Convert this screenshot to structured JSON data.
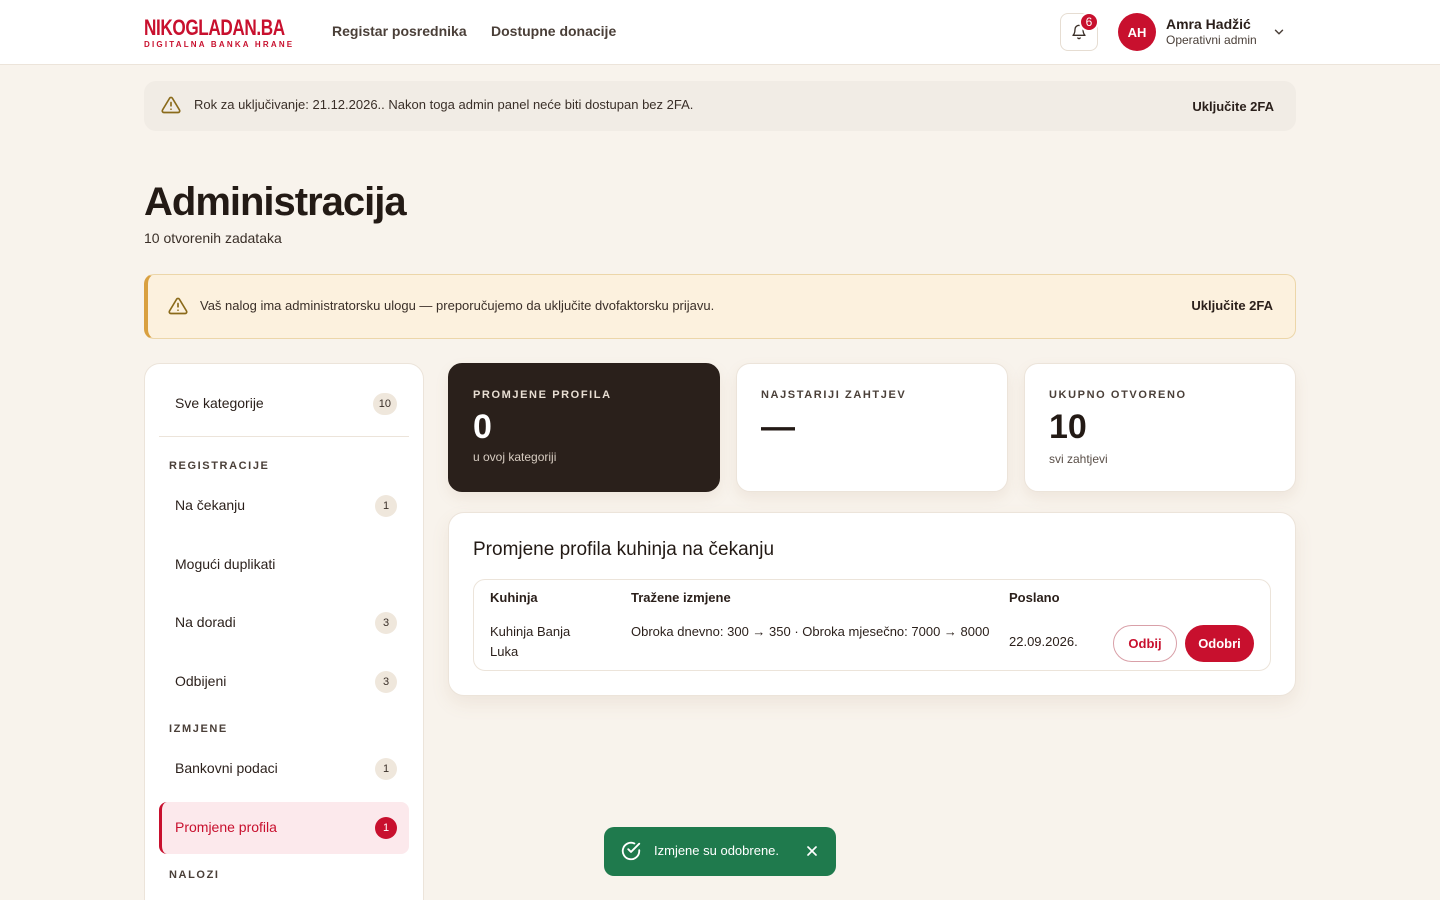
{
  "header": {
    "logo_main": "NIKOGLADAN.BA",
    "logo_sub": "DIGITALNA BANKA HRANE",
    "nav": [
      "Registar posrednika",
      "Dostupne donacije"
    ],
    "notifications_count": "6",
    "user": {
      "initials": "AH",
      "name": "Amra Hadžić",
      "role": "Operativni admin"
    }
  },
  "notice_top": {
    "text": "Rok za uključivanje: 21.12.2026.. Nakon toga admin panel neće biti dostupan bez 2FA.",
    "action": "Uključite 2FA"
  },
  "page": {
    "title": "Administracija",
    "subtitle": "10 otvorenih zadataka"
  },
  "notice_2fa": {
    "text": "Vaš nalog ima administratorsku ulogu — preporučujemo da uključite dvofaktorsku prijavu.",
    "action": "Uključite 2FA"
  },
  "sidebar": {
    "all": {
      "label": "Sve kategorije",
      "count": "10"
    },
    "sections": [
      "REGISTRACIJE",
      "IZMJENE",
      "NALOZI"
    ],
    "items": [
      {
        "label": "Na čekanju",
        "count": "1"
      },
      {
        "label": "Mogući duplikati",
        "count": ""
      },
      {
        "label": "Na doradi",
        "count": "3"
      },
      {
        "label": "Odbijeni",
        "count": "3"
      },
      {
        "label": "Bankovni podaci",
        "count": "1"
      },
      {
        "label": "Promjene profila",
        "count": "1"
      }
    ]
  },
  "stats": [
    {
      "caption": "PROMJENE PROFILA",
      "value": "0",
      "note": "u ovoj kategoriji"
    },
    {
      "caption": "NAJSTARIJI ZAHTJEV",
      "value": "—",
      "note": ""
    },
    {
      "caption": "UKUPNO OTVORENO",
      "value": "10",
      "note": "svi zahtjevi"
    }
  ],
  "pending": {
    "title": "Promjene profila kuhinja na čekanju",
    "columns": [
      "Kuhinja",
      "Tražene izmjene",
      "Poslano"
    ],
    "rows": [
      {
        "kitchen": "Kuhinja Banja Luka",
        "changes": "Obroka dnevno: 300 → 350 · Obroka mjesečno: 7000 → 8000",
        "sent": "22.09.2026.",
        "reject": "Odbij",
        "approve": "Odobri"
      }
    ]
  },
  "toast": {
    "message": "Izmjene su odobrene."
  },
  "colors": {
    "brand": "#c8102e",
    "success": "#1f7a4d",
    "warning": "#d9a040",
    "dark_card": "#2a201b"
  }
}
